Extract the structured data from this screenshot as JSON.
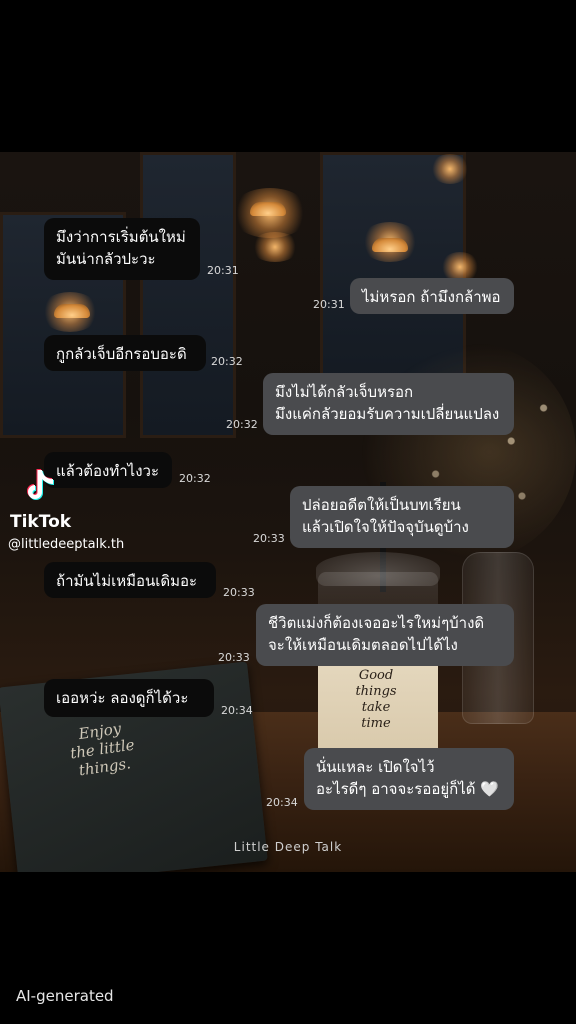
{
  "messages": [
    {
      "side": "left",
      "text": "มึงว่าการเริ่มต้นใหม่\nมันน่ากลัวปะวะ",
      "time": "20:31"
    },
    {
      "side": "right",
      "text": "ไม่หรอก ถ้ามึงกล้าพอ",
      "time": "20:31"
    },
    {
      "side": "left",
      "text": "กูกลัวเจ็บอีกรอบอะดิ",
      "time": "20:32"
    },
    {
      "side": "right",
      "text": "มึงไม่ได้กลัวเจ็บหรอก\nมึงแค่กลัวยอมรับความเปลี่ยนแปลง",
      "time": "20:32"
    },
    {
      "side": "left",
      "text": "แล้วต้องทำไงวะ",
      "time": "20:32"
    },
    {
      "side": "right",
      "text": "ปล่อยอดีตให้เป็นบทเรียน\nแล้วเปิดใจให้ปัจจุบันดูบ้าง",
      "time": "20:33"
    },
    {
      "side": "left",
      "text": "ถ้ามันไม่เหมือนเดิมอะ",
      "time": "20:33"
    },
    {
      "side": "right",
      "text": "ชีวิตแม่งก็ต้องเจออะไรใหม่ๆบ้างดิ\nจะให้เหมือนเดิมตลอดไปได้ไง",
      "time": "20:33"
    },
    {
      "side": "left",
      "text": "เออหว่ะ ลองดูก็ได้วะ",
      "time": "20:34"
    },
    {
      "side": "right",
      "text": "นั่นแหละ เปิดใจไว้\nอะไรดีๆ อาจจะรออยู่ก็ได้ 🤍",
      "time": "20:34"
    }
  ],
  "watermark": {
    "brand": "TikTok",
    "handle": "@littledeeptalk.th",
    "icon": "tiktok-note-icon"
  },
  "scene_text": {
    "notebook": "Enjoy\nthe little\nthings.",
    "cup": "Good\nthings\ntake\ntime"
  },
  "credit": "Little Deep Talk",
  "ai_label": "AI-generated",
  "colors": {
    "left_bubble": "#0b0b0b",
    "right_bubble": "#4a4b4e",
    "background": "#000000"
  }
}
